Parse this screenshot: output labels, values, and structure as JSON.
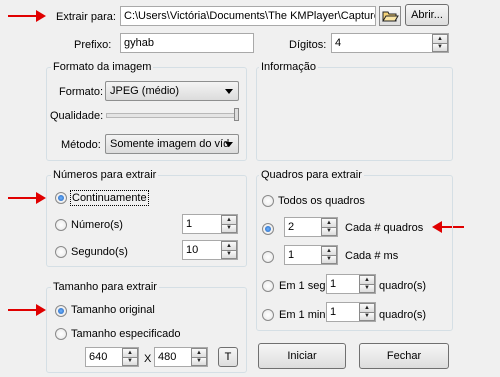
{
  "top": {
    "extract_label": "Extrair para:",
    "extract_path": "C:\\Users\\Victória\\Documents\\The KMPlayer\\Capture\\",
    "open_label": "Abrir...",
    "prefix_label": "Prefixo:",
    "prefix_value": "gyhab",
    "digits_label": "Dígitos:",
    "digits_value": "4"
  },
  "format_group": {
    "title": "Formato da imagem",
    "format_label": "Formato:",
    "format_value": "JPEG (médio)",
    "quality_label": "Qualidade:",
    "method_label": "Método:",
    "method_value": "Somente imagem do víd"
  },
  "info_group": {
    "title": "Informação"
  },
  "numbers_group": {
    "title": "Números para extrair",
    "continuous_label": "Continuamente",
    "number_label": "Número(s)",
    "number_value": "1",
    "second_label": "Segundo(s)",
    "second_value": "10"
  },
  "frames_group": {
    "title": "Quadros para extrair",
    "all_label": "Todos os quadros",
    "every_frames_value": "2",
    "every_frames_label": "Cada # quadros",
    "every_ms_value": "1",
    "every_ms_label": "Cada # ms",
    "in_sec_label": "Em 1 seg.",
    "in_sec_value": "1",
    "in_sec_unit": "quadro(s)",
    "in_min_label": "Em 1 min.",
    "in_min_value": "1",
    "in_min_unit": "quadro(s)"
  },
  "size_group": {
    "title": "Tamanho para extrair",
    "original_label": "Tamanho original",
    "specified_label": "Tamanho especificado",
    "width_value": "640",
    "x_label": "X",
    "height_value": "480",
    "t_label": "T"
  },
  "buttons": {
    "start_label": "Iniciar",
    "close_label": "Fechar"
  },
  "colors": {
    "annotation_arrow": "#e00000",
    "selection": "#1d5fb8"
  }
}
